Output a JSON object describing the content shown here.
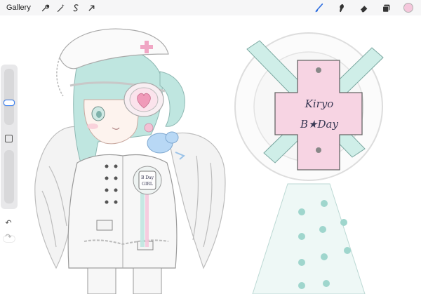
{
  "app": {
    "gallery_label": "Gallery"
  },
  "toolbar": {
    "left_tools": [
      "wrench-icon",
      "magic-wand-icon",
      "selection-s-icon",
      "transform-arrow-icon"
    ],
    "right_tools": [
      "brush-icon",
      "smudge-icon",
      "eraser-icon",
      "layers-icon"
    ],
    "active_tool": "brush-icon",
    "accent_color": "#2f6fe0",
    "current_color": "#f5c7dc"
  },
  "sidebar": {
    "undo_label": "↶",
    "redo_label": "↷"
  },
  "canvas": {
    "badge_line1": "Kiryo",
    "badge_line2": "B★Day",
    "small_badge_line1": "B Day",
    "small_badge_line2": "GIRL"
  }
}
